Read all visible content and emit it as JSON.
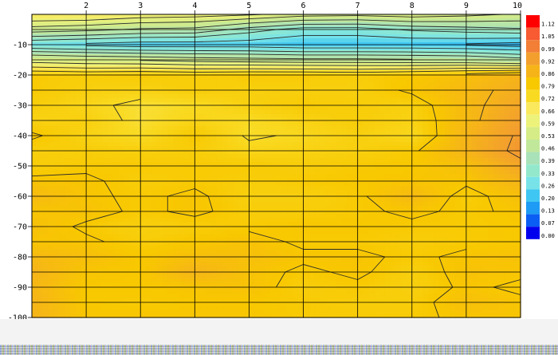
{
  "chart_data": {
    "type": "heatmap",
    "title": "",
    "xlabel": "",
    "ylabel": "",
    "x_ticks": [
      2,
      3,
      4,
      5,
      6,
      7,
      8,
      9,
      10
    ],
    "xlim": [
      1,
      10
    ],
    "y_ticks": [
      -10,
      -20,
      -30,
      -40,
      -50,
      -60,
      -70,
      -80,
      -90,
      -100
    ],
    "ylim": [
      -100,
      0
    ],
    "x": [
      1,
      2,
      3,
      4,
      5,
      6,
      7,
      8,
      9,
      10
    ],
    "y": [
      0,
      -5,
      -10,
      -15,
      -20,
      -25,
      -30,
      -35,
      -40,
      -45,
      -50,
      -55,
      -60,
      -65,
      -70,
      -75,
      -80,
      -85,
      -90,
      -95,
      -100
    ],
    "z": [
      [
        0.66,
        0.66,
        0.63,
        0.62,
        0.6,
        0.56,
        0.55,
        0.57,
        0.55,
        0.52
      ],
      [
        0.5,
        0.48,
        0.45,
        0.44,
        0.36,
        0.3,
        0.3,
        0.34,
        0.36,
        0.38
      ],
      [
        0.26,
        0.24,
        0.22,
        0.22,
        0.22,
        0.2,
        0.2,
        0.2,
        0.19,
        0.17
      ],
      [
        0.55,
        0.53,
        0.52,
        0.5,
        0.49,
        0.48,
        0.48,
        0.47,
        0.46,
        0.42
      ],
      [
        0.78,
        0.77,
        0.78,
        0.77,
        0.78,
        0.78,
        0.77,
        0.79,
        0.82,
        0.86
      ],
      [
        0.78,
        0.76,
        0.75,
        0.77,
        0.76,
        0.76,
        0.76,
        0.8,
        0.84,
        0.88
      ],
      [
        0.77,
        0.74,
        0.7,
        0.72,
        0.76,
        0.78,
        0.77,
        0.76,
        0.84,
        0.9
      ],
      [
        0.75,
        0.76,
        0.7,
        0.74,
        0.72,
        0.75,
        0.77,
        0.75,
        0.84,
        0.92
      ],
      [
        0.8,
        0.75,
        0.72,
        0.79,
        0.71,
        0.73,
        0.76,
        0.73,
        0.86,
        0.93
      ],
      [
        0.76,
        0.77,
        0.76,
        0.77,
        0.74,
        0.75,
        0.76,
        0.78,
        0.86,
        0.94
      ],
      [
        0.77,
        0.78,
        0.78,
        0.78,
        0.78,
        0.77,
        0.78,
        0.79,
        0.82,
        0.9
      ],
      [
        0.8,
        0.8,
        0.77,
        0.78,
        0.77,
        0.78,
        0.79,
        0.8,
        0.8,
        0.86
      ],
      [
        0.84,
        0.8,
        0.78,
        0.8,
        0.76,
        0.76,
        0.78,
        0.84,
        0.77,
        0.82
      ],
      [
        0.8,
        0.81,
        0.78,
        0.8,
        0.77,
        0.77,
        0.78,
        0.8,
        0.78,
        0.8
      ],
      [
        0.82,
        0.78,
        0.76,
        0.77,
        0.78,
        0.79,
        0.79,
        0.78,
        0.78,
        0.79
      ],
      [
        0.8,
        0.8,
        0.77,
        0.79,
        0.81,
        0.78,
        0.78,
        0.77,
        0.78,
        0.79
      ],
      [
        0.84,
        0.82,
        0.79,
        0.82,
        0.82,
        0.8,
        0.8,
        0.78,
        0.8,
        0.81
      ],
      [
        0.86,
        0.8,
        0.79,
        0.86,
        0.81,
        0.78,
        0.8,
        0.76,
        0.81,
        0.8
      ],
      [
        0.85,
        0.79,
        0.79,
        0.8,
        0.81,
        0.77,
        0.78,
        0.76,
        0.8,
        0.78
      ],
      [
        0.86,
        0.79,
        0.78,
        0.79,
        0.79,
        0.78,
        0.77,
        0.77,
        0.82,
        0.8
      ],
      [
        0.86,
        0.8,
        0.8,
        0.8,
        0.8,
        0.78,
        0.78,
        0.78,
        0.8,
        0.8
      ]
    ],
    "color_scale": {
      "labels": [
        "1.12",
        "1.05",
        "0.99",
        "0.92",
        "0.86",
        "0.79",
        "0.72",
        "0.66",
        "0.59",
        "0.53",
        "0.46",
        "0.39",
        "0.33",
        "0.26",
        "0.20",
        "0.13",
        "0.07",
        "0.00"
      ],
      "colors": [
        "#ff0000",
        "#f85a32",
        "#f27f35",
        "#f39f2e",
        "#f6b419",
        "#f8c800",
        "#f9da22",
        "#fae95c",
        "#ecf27a",
        "#d6ec86",
        "#c1e79b",
        "#a9e2b8",
        "#93e8cc",
        "#77e3e8",
        "#3fc6f2",
        "#1e9bf4",
        "#0b5ef3",
        "#0000ee"
      ]
    },
    "grid": true,
    "legend": "right"
  }
}
